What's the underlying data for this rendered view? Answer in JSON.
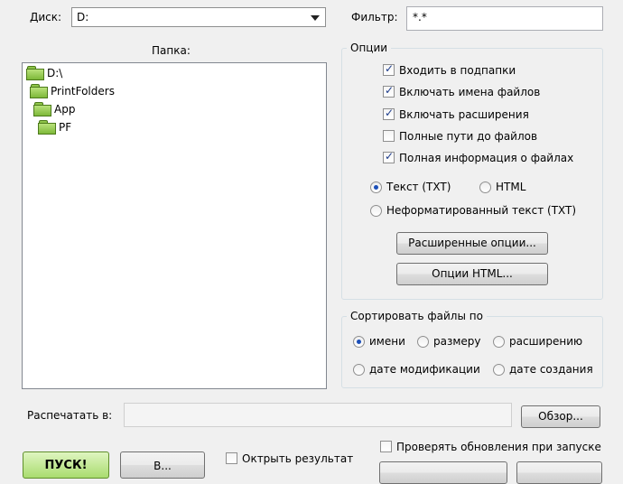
{
  "drive": {
    "label": "Диск:",
    "value": "D:"
  },
  "filter": {
    "label": "Фильтр:",
    "value": "*.*"
  },
  "folder_label": "Папка:",
  "tree": [
    "D:\\",
    "PrintFolders",
    "App",
    "PF"
  ],
  "options": {
    "title": "Опции",
    "checks": [
      {
        "label": "Входить в подпапки",
        "checked": true
      },
      {
        "label": "Включать имена файлов",
        "checked": true
      },
      {
        "label": "Включать расширения",
        "checked": true
      },
      {
        "label": "Полные пути до файлов",
        "checked": false
      },
      {
        "label": "Полная информация о файлах",
        "checked": true
      }
    ],
    "format": [
      {
        "label": "Текст (TXT)",
        "selected": true
      },
      {
        "label": "HTML",
        "selected": false
      },
      {
        "label": "Неформатированный текст (TXT)",
        "selected": false
      }
    ],
    "advanced_button": "Расширенные опции...",
    "html_button": "Опции HTML..."
  },
  "sort": {
    "title": "Сортировать файлы по",
    "options": [
      {
        "label": "имени",
        "selected": true
      },
      {
        "label": "размеру",
        "selected": false
      },
      {
        "label": "расширению",
        "selected": false
      },
      {
        "label": "дате модификации",
        "selected": false
      },
      {
        "label": "дате создания",
        "selected": false
      }
    ]
  },
  "print_to": {
    "label": "Распечатать в:",
    "value": "",
    "browse": "Обзор..."
  },
  "bottom": {
    "go": "ПУСК!",
    "second": "В...",
    "open_result": "Октрыть результат",
    "check_updates": "Проверять обновления при запуске"
  }
}
